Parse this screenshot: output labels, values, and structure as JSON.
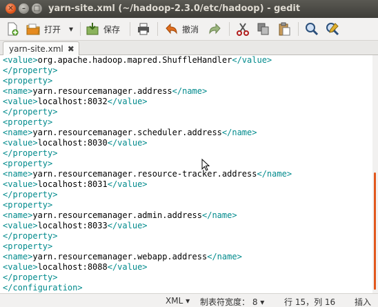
{
  "window": {
    "title": "yarn-site.xml (~/hadoop-2.3.0/etc/hadoop) - gedit",
    "close_glyph": "✕",
    "min_glyph": "–",
    "max_glyph": "□"
  },
  "toolbar": {
    "open_label": "打开",
    "open_arrow": "▾",
    "save_label": "保存",
    "undo_label": "撤消"
  },
  "tab": {
    "label": "yarn-site.xml",
    "close_glyph": "✖"
  },
  "lines": [
    [
      {
        "t": "tag",
        "v": "<value>"
      },
      {
        "t": "txt",
        "v": "org.apache.hadoop.mapred.ShuffleHandler"
      },
      {
        "t": "tag",
        "v": "</value>"
      }
    ],
    [
      {
        "t": "tag",
        "v": "</property>"
      }
    ],
    [
      {
        "t": "tag",
        "v": "<property>"
      }
    ],
    [
      {
        "t": "tag",
        "v": "<name>"
      },
      {
        "t": "txt",
        "v": "yarn.resourcemanager.address"
      },
      {
        "t": "tag",
        "v": "</name>"
      }
    ],
    [
      {
        "t": "tag",
        "v": "<value>"
      },
      {
        "t": "txt",
        "v": "localhost:8032"
      },
      {
        "t": "tag",
        "v": "</value>"
      }
    ],
    [
      {
        "t": "tag",
        "v": "</property>"
      }
    ],
    [
      {
        "t": "tag",
        "v": "<property>"
      }
    ],
    [
      {
        "t": "tag",
        "v": "<name>"
      },
      {
        "t": "txt",
        "v": "yarn.resourcemanager.scheduler.address"
      },
      {
        "t": "tag",
        "v": "</name>"
      }
    ],
    [
      {
        "t": "tag",
        "v": "<value>"
      },
      {
        "t": "txt",
        "v": "localhost:8030"
      },
      {
        "t": "tag",
        "v": "</value>"
      }
    ],
    [
      {
        "t": "tag",
        "v": "</property>"
      }
    ],
    [
      {
        "t": "tag",
        "v": "<property>"
      }
    ],
    [
      {
        "t": "tag",
        "v": "<name>"
      },
      {
        "t": "txt",
        "v": "yarn.resourcemanager.resource-tracker.address"
      },
      {
        "t": "tag",
        "v": "</name>"
      }
    ],
    [
      {
        "t": "tag",
        "v": "<value>"
      },
      {
        "t": "txt",
        "v": "localhost:8031"
      },
      {
        "t": "tag",
        "v": "</value>"
      }
    ],
    [
      {
        "t": "tag",
        "v": "</property>"
      }
    ],
    [
      {
        "t": "tag",
        "v": "<property>"
      }
    ],
    [
      {
        "t": "tag",
        "v": "<name>"
      },
      {
        "t": "txt",
        "v": "yarn.resourcemanager.admin.address"
      },
      {
        "t": "tag",
        "v": "</name>"
      }
    ],
    [
      {
        "t": "tag",
        "v": "<value>"
      },
      {
        "t": "txt",
        "v": "localhost:8033"
      },
      {
        "t": "tag",
        "v": "</value>"
      }
    ],
    [
      {
        "t": "tag",
        "v": "</property>"
      }
    ],
    [
      {
        "t": "tag",
        "v": "<property>"
      }
    ],
    [
      {
        "t": "tag",
        "v": "<name>"
      },
      {
        "t": "txt",
        "v": "yarn.resourcemanager.webapp.address"
      },
      {
        "t": "tag",
        "v": "</name>"
      }
    ],
    [
      {
        "t": "tag",
        "v": "<value>"
      },
      {
        "t": "txt",
        "v": "localhost:8088"
      },
      {
        "t": "tag",
        "v": "</value>"
      }
    ],
    [
      {
        "t": "tag",
        "v": "</property>"
      }
    ],
    [
      {
        "t": "tag",
        "v": "</configuration>"
      }
    ]
  ],
  "statusbar": {
    "language": "XML",
    "tab_width": "制表符宽度： 8",
    "dropdown_arrow": "▾",
    "position": "行 15，列 16",
    "mode": "插入"
  },
  "colors": {
    "tag": "#008a8c",
    "accent": "#e2571c"
  }
}
